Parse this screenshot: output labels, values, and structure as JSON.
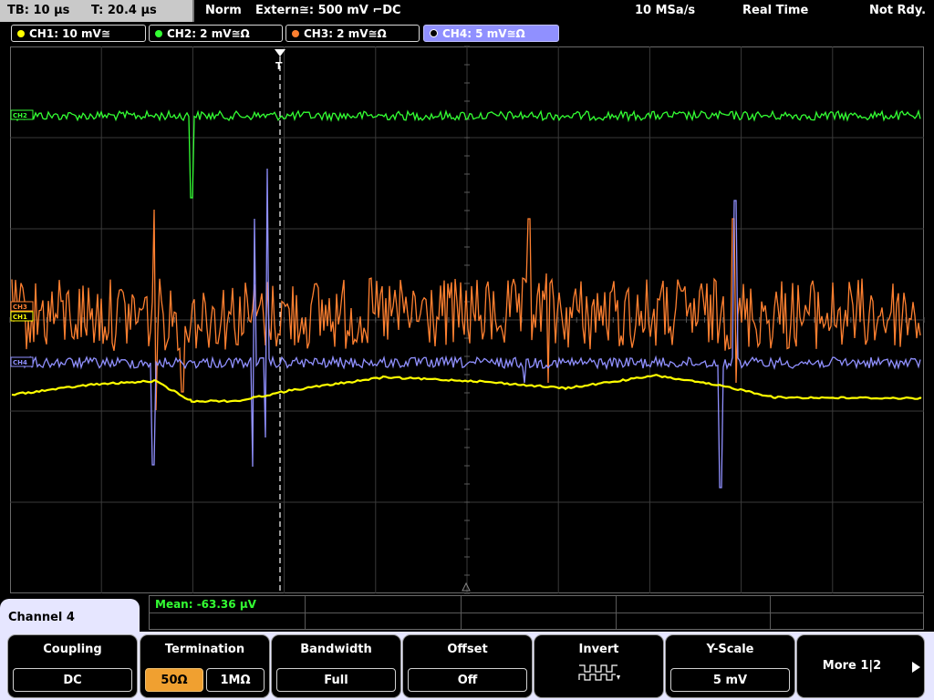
{
  "status": {
    "timebase": "TB: 10 µs",
    "trigger_time": "T: 20.4 µs",
    "mode": "Norm",
    "trigger_source": "Extern≅: 500 mV ⌐DC",
    "sample_rate": "10 MSa/s",
    "acq_mode": "Real Time",
    "state": "Not Rdy."
  },
  "channels": [
    {
      "label": "CH1: 10 mV≅",
      "color": "#ffff00"
    },
    {
      "label": "CH2: 2 mV≅Ω",
      "color": "#33ff33"
    },
    {
      "label": "CH3: 2 mV≅Ω",
      "color": "#ff8030"
    },
    {
      "label": "CH4: 5 mV≅Ω",
      "color": "#9090ff"
    }
  ],
  "markers": {
    "ch2": "CH2",
    "ch3": "CH3",
    "ch4": "CH4",
    "ch1": "CH1",
    "trigger": "T"
  },
  "measurement": {
    "mean": "Mean: -63.36 µV"
  },
  "menu": {
    "title": "Channel 4",
    "coupling": {
      "title": "Coupling",
      "value": "DC"
    },
    "termination": {
      "title": "Termination",
      "opt1": "50Ω",
      "opt2": "1MΩ"
    },
    "bandwidth": {
      "title": "Bandwidth",
      "value": "Full"
    },
    "offset": {
      "title": "Offset",
      "value": "Off"
    },
    "invert": {
      "title": "Invert",
      "icon": "invert-pulse-icon"
    },
    "yscale": {
      "title": "Y-Scale",
      "value": "5 mV"
    },
    "more": {
      "label": "More 1|2"
    }
  }
}
